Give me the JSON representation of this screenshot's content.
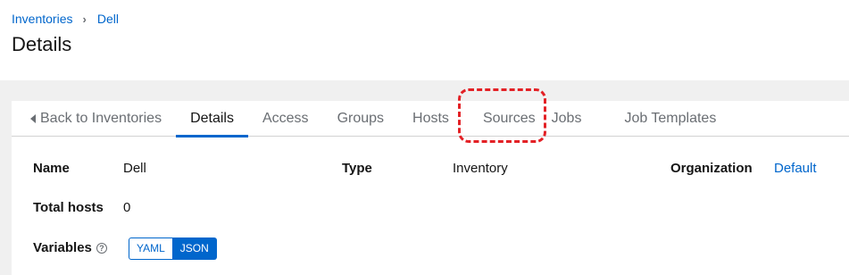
{
  "breadcrumb": {
    "items": [
      "Inventories",
      "Dell"
    ],
    "separator": "›"
  },
  "page_title": "Details",
  "tabs": [
    {
      "label": "Back to Inventories",
      "active": false
    },
    {
      "label": "Details",
      "active": true
    },
    {
      "label": "Access",
      "active": false
    },
    {
      "label": "Groups",
      "active": false
    },
    {
      "label": "Hosts",
      "active": false
    },
    {
      "label": "Sources",
      "active": false
    },
    {
      "label": "Jobs",
      "active": false
    },
    {
      "label": "Job Templates",
      "active": false
    }
  ],
  "details": {
    "name": {
      "label": "Name",
      "value": "Dell"
    },
    "type": {
      "label": "Type",
      "value": "Inventory"
    },
    "organization": {
      "label": "Organization",
      "value": "Default"
    },
    "total_hosts": {
      "label": "Total hosts",
      "value": "0"
    },
    "variables": {
      "label": "Variables",
      "help": "?"
    }
  },
  "variables_format": {
    "options": [
      "YAML",
      "JSON"
    ],
    "selected": "JSON"
  },
  "icons": {
    "back": "caret-left-icon",
    "help": "question-circle-icon",
    "breadcrumb_separator": "chevron-right-icon"
  },
  "colors": {
    "link": "#0066cc",
    "active_tab_underline": "#0066cc",
    "annotation": "#e32126",
    "band": "#f0f0f0"
  }
}
